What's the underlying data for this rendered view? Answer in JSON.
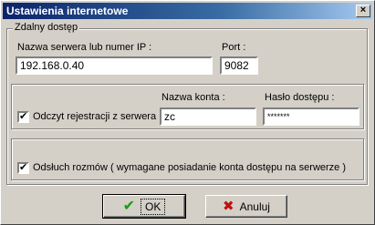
{
  "window": {
    "title": "Ustawienia internetowe",
    "close_glyph": "×"
  },
  "group": {
    "label": "Zdalny dostęp"
  },
  "server": {
    "label": "Nazwa serwera lub numer IP :",
    "value": "192.168.0.40",
    "port_label": "Port :",
    "port_value": "9082"
  },
  "registration": {
    "checkbox_label": "Odczyt rejestracji z serwera",
    "checked_glyph": "✔",
    "account_label": "Nazwa konta :",
    "account_value": "zc",
    "password_label": "Hasło dostępu :",
    "password_value": "*******"
  },
  "listening": {
    "checkbox_label": "Odsłuch rozmów ( wymagane posiadanie konta dostępu na serwerze )",
    "checked_glyph": "✔"
  },
  "buttons": {
    "ok_label": "OK",
    "ok_icon": "✔",
    "cancel_label": "Anuluj",
    "cancel_icon": "✖"
  }
}
